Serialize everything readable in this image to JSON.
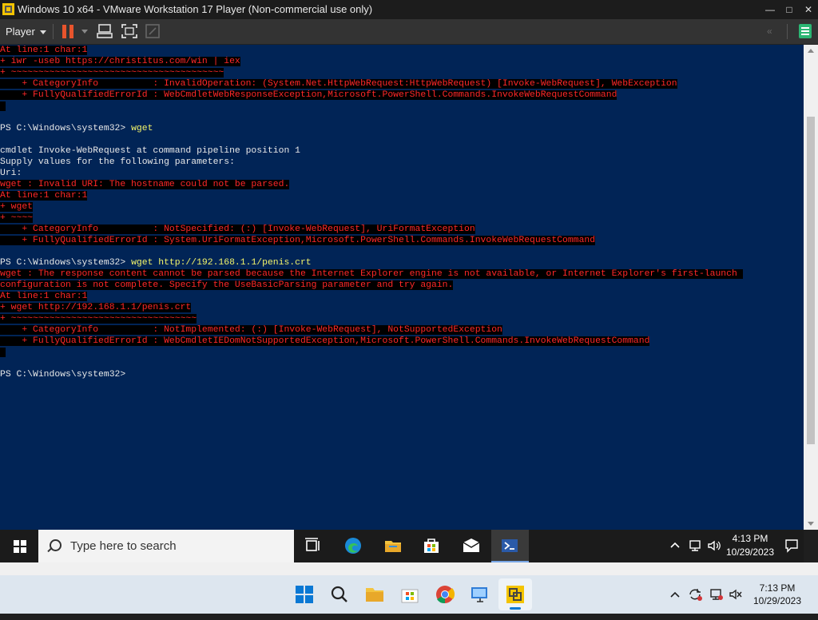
{
  "vm": {
    "title": "Windows 10 x64 - VMware Workstation 17 Player (Non-commercial use only)",
    "player_menu": "Player",
    "accent": "#e8542c"
  },
  "console": {
    "lines": [
      {
        "text": "At line:1 char:1",
        "type": "err"
      },
      {
        "text": "+ iwr -useb https://christitus.com/win | iex",
        "type": "err"
      },
      {
        "text": "+ ~~~~~~~~~~~~~~~~~~~~~~~~~~~~~~~~~~~~~~~",
        "type": "err"
      },
      {
        "text": "    + CategoryInfo          : InvalidOperation: (System.Net.HttpWebRequest:HttpWebRequest) [Invoke-WebRequest], WebException",
        "type": "err"
      },
      {
        "text": "    + FullyQualifiedErrorId : WebCmdletWebResponseException,Microsoft.PowerShell.Commands.InvokeWebRequestCommand",
        "type": "err"
      },
      {
        "text": " ",
        "type": "err"
      },
      {
        "text": "",
        "type": "plain"
      },
      {
        "prompt": "PS C:\\Windows\\system32> ",
        "cmd": "wget",
        "type": "prompt"
      },
      {
        "text": "",
        "type": "plain"
      },
      {
        "text": "cmdlet Invoke-WebRequest at command pipeline position 1",
        "type": "plain"
      },
      {
        "text": "Supply values for the following parameters:",
        "type": "plain"
      },
      {
        "text": "Uri:",
        "type": "plain"
      },
      {
        "text": "wget : Invalid URI: The hostname could not be parsed.",
        "type": "err"
      },
      {
        "text": "At line:1 char:1",
        "type": "err"
      },
      {
        "text": "+ wget",
        "type": "err"
      },
      {
        "text": "+ ~~~~",
        "type": "err"
      },
      {
        "text": "    + CategoryInfo          : NotSpecified: (:) [Invoke-WebRequest], UriFormatException",
        "type": "err"
      },
      {
        "text": "    + FullyQualifiedErrorId : System.UriFormatException,Microsoft.PowerShell.Commands.InvokeWebRequestCommand",
        "type": "err"
      },
      {
        "text": "",
        "type": "plain"
      },
      {
        "prompt": "PS C:\\Windows\\system32> ",
        "cmd": "wget http://192.168.1.1/penis.crt",
        "type": "prompt"
      },
      {
        "text": "wget : The response content cannot be parsed because the Internet Explorer engine is not available, or Internet Explorer's first-launch ",
        "type": "err"
      },
      {
        "text": "configuration is not complete. Specify the UseBasicParsing parameter and try again.",
        "type": "err"
      },
      {
        "text": "At line:1 char:1",
        "type": "err"
      },
      {
        "text": "+ wget http://192.168.1.1/penis.crt",
        "type": "err"
      },
      {
        "text": "+ ~~~~~~~~~~~~~~~~~~~~~~~~~~~~~~~~~~",
        "type": "err"
      },
      {
        "text": "    + CategoryInfo          : NotImplemented: (:) [Invoke-WebRequest], NotSupportedException",
        "type": "err"
      },
      {
        "text": "    + FullyQualifiedErrorId : WebCmdletIEDomNotSupportedException,Microsoft.PowerShell.Commands.InvokeWebRequestCommand",
        "type": "err"
      },
      {
        "text": " ",
        "type": "err"
      },
      {
        "text": "",
        "type": "plain"
      },
      {
        "prompt": "PS C:\\Windows\\system32> ",
        "cmd": "",
        "type": "prompt"
      }
    ]
  },
  "guest_taskbar": {
    "search_placeholder": "Type here to search",
    "time": "4:13 PM",
    "date": "10/29/2023"
  },
  "host_taskbar": {
    "time": "7:13 PM",
    "date": "10/29/2023"
  }
}
